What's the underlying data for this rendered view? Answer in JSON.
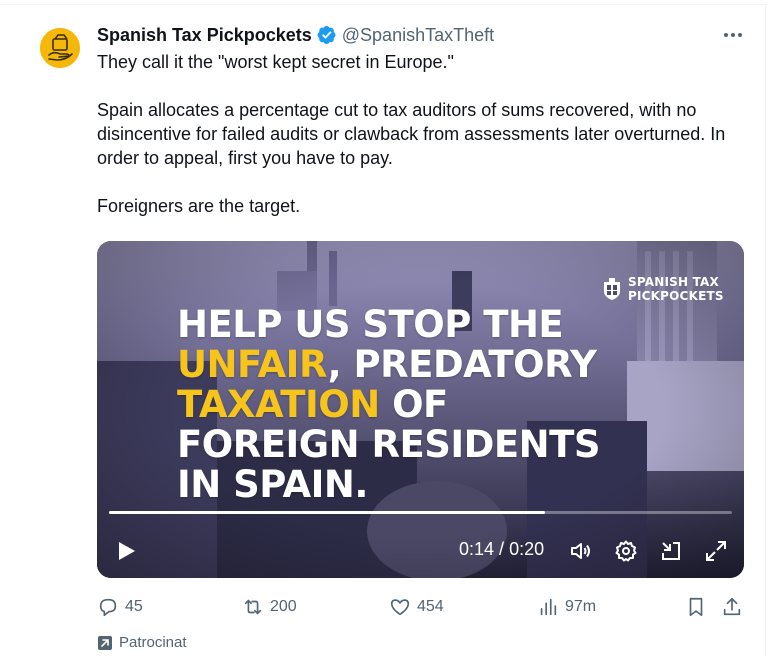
{
  "author": {
    "display_name": "Spanish Tax Pickpockets",
    "handle": "@SpanishTaxTheft",
    "verified": true
  },
  "tweet": {
    "paragraphs": [
      "They call it the \"worst kept secret in Europe.\"",
      "Spain allocates a percentage cut to tax auditors of sums recovered, with no disincentive for failed audits or clawback from assessments later overturned. In order to appeal, first you have to pay.",
      "Foreigners are the target."
    ]
  },
  "video": {
    "overlay_lines": [
      {
        "parts": [
          {
            "text": "HELP US STOP THE",
            "highlight": false
          }
        ]
      },
      {
        "parts": [
          {
            "text": "UNFAIR",
            "highlight": true
          },
          {
            "text": ", PREDATORY",
            "highlight": false
          }
        ]
      },
      {
        "parts": [
          {
            "text": "TAXATION",
            "highlight": true
          },
          {
            "text": " OF",
            "highlight": false
          }
        ]
      },
      {
        "parts": [
          {
            "text": "FOREIGN RESIDENTS",
            "highlight": false
          }
        ]
      },
      {
        "parts": [
          {
            "text": "IN SPAIN.",
            "highlight": false
          }
        ]
      }
    ],
    "brand_line1": "SPANISH TAX",
    "brand_line2": "PICKPOCKETS",
    "current_time": "0:14",
    "separator": " / ",
    "duration": "0:20",
    "progress_fraction": 0.7,
    "highlight_color": "#f6c41a"
  },
  "actions": {
    "replies": "45",
    "reposts": "200",
    "likes": "454",
    "views": "97m"
  },
  "promoted_label": "Patrocinat",
  "colors": {
    "verified_blue": "#1d9bf0",
    "secondary_text": "#536471",
    "avatar_bg": "#f5b80a"
  }
}
